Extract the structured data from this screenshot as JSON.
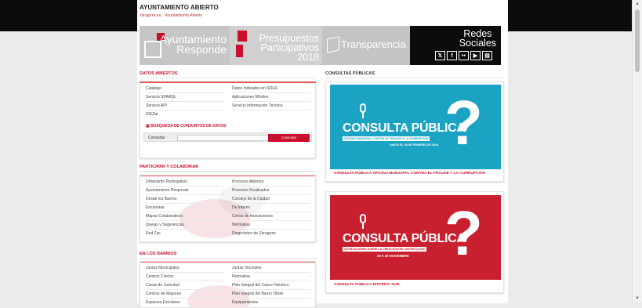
{
  "header": {
    "site_title": "AYUNTAMIENTO ABIERTO",
    "breadcrumb": [
      "zaragoza.es",
      "Ayuntamiento Abierto"
    ],
    "breadcrumb_sep": "/"
  },
  "banners": [
    {
      "line1": "Ayuntamiento",
      "line2": "Responde",
      "line3": ""
    },
    {
      "line1": "Presupuestos",
      "line2": "Participativos",
      "line3": "2018"
    },
    {
      "line1": "Transparencia",
      "line2": "",
      "line3": ""
    },
    {
      "line1": "Redes",
      "line2": "Sociales",
      "line3": ""
    }
  ],
  "social_icons": [
    {
      "icon": "twitter-icon",
      "glyph": "𝕏"
    },
    {
      "icon": "facebook-icon",
      "glyph": "f"
    },
    {
      "icon": "flickr-icon",
      "glyph": "••"
    },
    {
      "icon": "youtube-icon",
      "glyph": "▶"
    },
    {
      "icon": "blog-icon",
      "glyph": "▤"
    }
  ],
  "datos_abiertos": {
    "title": "DATOS ABIERTOS",
    "left": [
      "Catálogo",
      "Servicio SPARQL",
      "Servicio API",
      "IDEZar"
    ],
    "right": [
      "Datos Indizados en SOLR",
      "Aplicaciones Móviles",
      "Servicio Información Técnica"
    ],
    "search_title": "BUSQUEDA DE CONJUNTOS DE DATOS",
    "search_label": "Consultar",
    "search_placeholder": "...",
    "search_button": "Consultar"
  },
  "participar": {
    "title": "PARTICIPAR Y COLABORAR",
    "left": [
      "Urbanismo Participativo",
      "Ayuntamiento Responde",
      "Desde los Barrios",
      "Encuestas",
      "Mapas Colaborativos",
      "Quejas y Sugerencias",
      "Red Zac"
    ],
    "right": [
      "Procesos Abiertos",
      "Procesos Finalizados",
      "Consejo de la Ciudad",
      "De Interés",
      "Censo de Asociaciones",
      "Normativa",
      "Diagnóstico de Zaragoza"
    ]
  },
  "barrios": {
    "title": "EN LOS BARRIOS",
    "left": [
      "Juntas Municipales",
      "Centros Cívicos",
      "Casas de Juventud",
      "Centros de Mayores",
      "Espacios Escolares"
    ],
    "right": [
      "Juntas Vecinales",
      "Normativa",
      "Plan Integral del Casco Histórico",
      "Plan Integral del Barrio Oliver",
      "Equipamientos"
    ]
  },
  "consultas": {
    "title": "CONSULTAS PÚBLICAS",
    "items": [
      {
        "headline": "CONSULTA PÚBLICA",
        "subtitle": "OFICINA MUNICIPAL CONTRA EL FRAUDE Y LA CORRUPCIÓN",
        "date": "HASTA EL 28 DE FEBRERO DE 2018",
        "caption": "CONSULTA PÚBLICA OFICINA MUNICIPAL CONTRA EL FRAUDE Y LA CORRUPCIÓN",
        "color": "#1aa3c2"
      },
      {
        "headline": "CONSULTA PÚBLICA",
        "subtitle": "APORTACIONES SOBRE LA CREACIÓN DEL DISTRITO SUR",
        "date": "19 A 29 NOVIEMBRE",
        "caption": "CONSULTA PÚBLICA DISTRITO SUR",
        "color": "#c8202e"
      }
    ]
  },
  "colors": {
    "brand_red": "#c8102e",
    "black": "#0c0c0c"
  }
}
